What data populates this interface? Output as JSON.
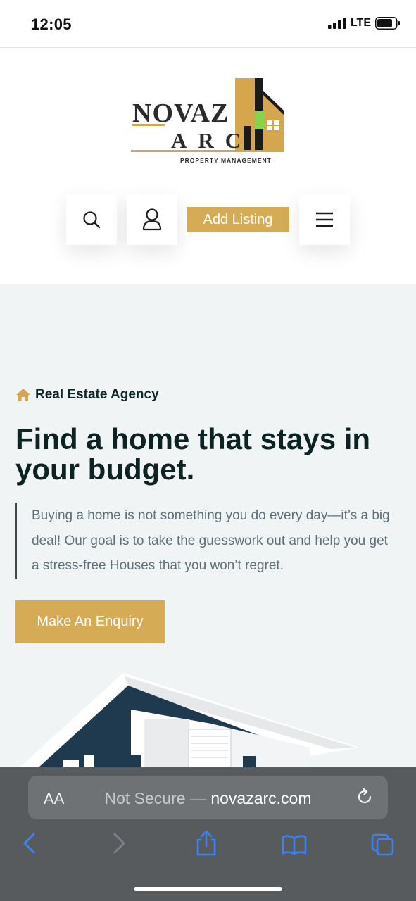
{
  "status_bar": {
    "time": "12:05",
    "network": "LTE"
  },
  "logo": {
    "name": "NOVAZ",
    "sub": "ARC",
    "tagline": "PROPERTY MANAGEMENT"
  },
  "nav": {
    "add_listing_label": "Add Listing"
  },
  "hero": {
    "eyebrow": "Real Estate Agency",
    "title": "Find a home that stays in your budget.",
    "description": "Buying a home is not something you do every day—it’s a big deal! Our goal is to take the guesswork out and help you get a stress-free Houses that you won’t regret.",
    "cta_label": "Make An Enquiry"
  },
  "browser": {
    "text_size_label": "AA",
    "security_label": "Not Secure —",
    "host": "novazarc.com"
  },
  "colors": {
    "accent": "#d6ab55",
    "heading": "#0d2222",
    "hero_bg": "#f0f4f5",
    "browser_chrome": "#585b5e",
    "toolbar_icon": "#3b82f6"
  },
  "icons": [
    "search-icon",
    "user-icon",
    "menu-icon",
    "home-icon",
    "reload-icon",
    "back-icon",
    "forward-icon",
    "share-icon",
    "bookmarks-icon",
    "tabs-icon"
  ]
}
